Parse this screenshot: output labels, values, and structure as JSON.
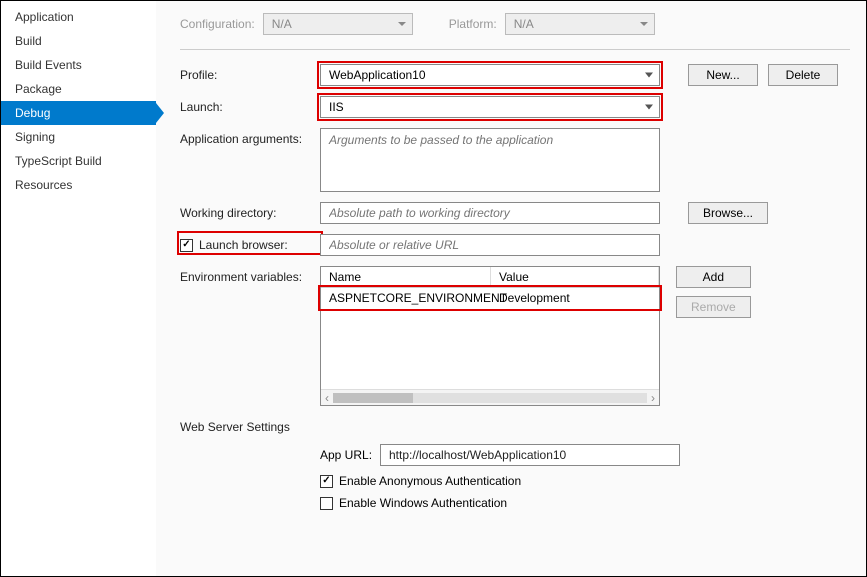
{
  "sidebar": {
    "items": [
      {
        "label": "Application"
      },
      {
        "label": "Build"
      },
      {
        "label": "Build Events"
      },
      {
        "label": "Package"
      },
      {
        "label": "Debug",
        "active": true
      },
      {
        "label": "Signing"
      },
      {
        "label": "TypeScript Build"
      },
      {
        "label": "Resources"
      }
    ]
  },
  "toprow": {
    "config_label": "Configuration:",
    "config_value": "N/A",
    "platform_label": "Platform:",
    "platform_value": "N/A"
  },
  "form": {
    "profile_label": "Profile:",
    "profile_value": "WebApplication10",
    "new_btn": "New...",
    "delete_btn": "Delete",
    "launch_label": "Launch:",
    "launch_value": "IIS",
    "args_label": "Application arguments:",
    "args_placeholder": "Arguments to be passed to the application",
    "workdir_label": "Working directory:",
    "workdir_placeholder": "Absolute path to working directory",
    "browse_btn": "Browse...",
    "launch_browser_label": "Launch browser:",
    "launch_browser_placeholder": "Absolute or relative URL",
    "envvars_label": "Environment variables:",
    "env_col_name": "Name",
    "env_col_value": "Value",
    "env_rows": [
      {
        "name": "ASPNETCORE_ENVIRONMENT",
        "value": "Development"
      }
    ],
    "add_btn": "Add",
    "remove_btn": "Remove"
  },
  "webserver": {
    "title": "Web Server Settings",
    "appurl_label": "App URL:",
    "appurl_value": "http://localhost/WebApplication10",
    "anon_label": "Enable Anonymous Authentication",
    "anon_checked": true,
    "win_label": "Enable Windows Authentication",
    "win_checked": false
  }
}
